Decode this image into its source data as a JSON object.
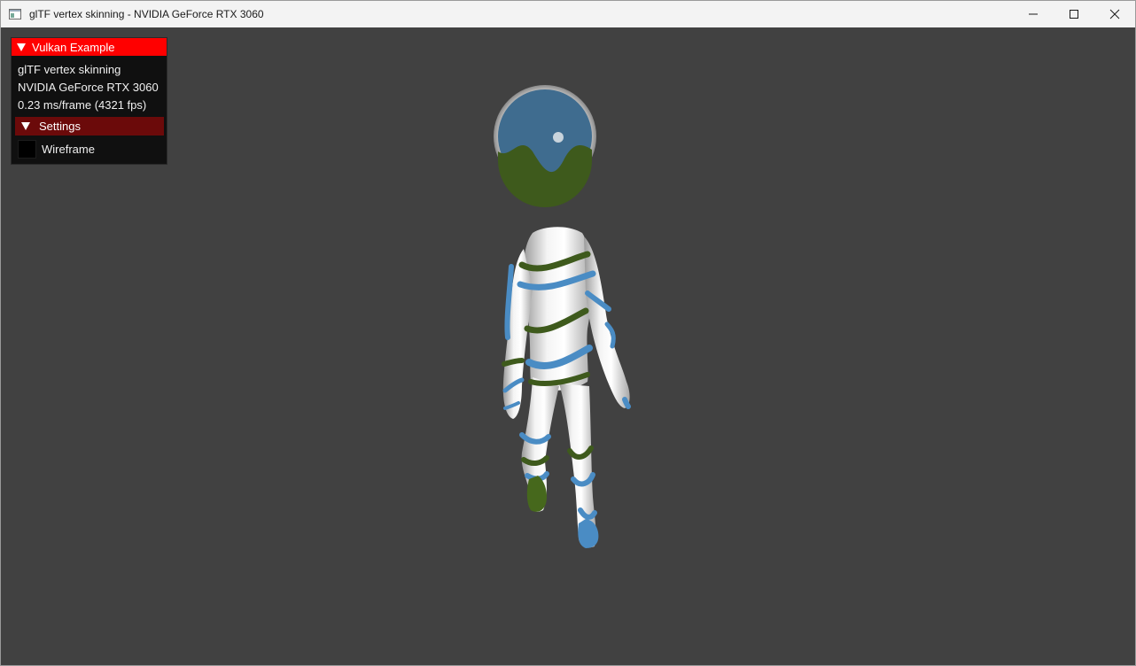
{
  "window": {
    "title": "glTF vertex skinning - NVIDIA GeForce RTX 3060"
  },
  "overlay": {
    "header_label": "Vulkan Example",
    "lines": [
      "glTF vertex skinning",
      "NVIDIA GeForce RTX 3060",
      "0.23 ms/frame (4321 fps)"
    ],
    "settings_label": "Settings",
    "wireframe_label": "Wireframe",
    "wireframe_checked": false
  },
  "colors": {
    "viewport_bg": "#414141",
    "overlay_header": "#ff0000",
    "settings_header": "#6b0a0a",
    "model_blue": "#4a8cc4",
    "model_green": "#4a6b1c"
  },
  "icons": [
    "app-window-icon",
    "minimize-icon",
    "maximize-icon",
    "close-icon"
  ]
}
